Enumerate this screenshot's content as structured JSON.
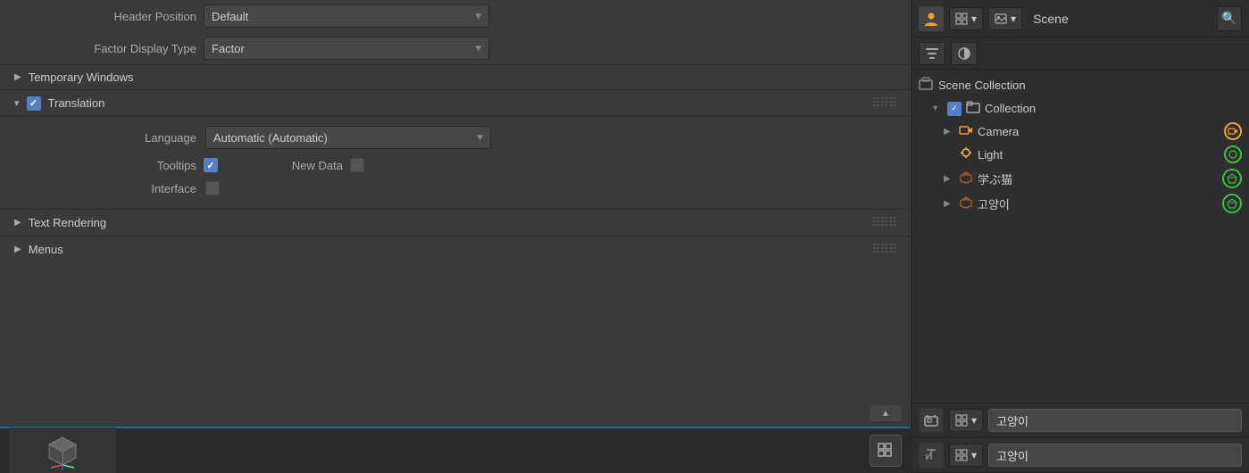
{
  "header_position": {
    "label": "Header Position",
    "dropdown_value": "Default",
    "dropdown_arrow": "▾"
  },
  "factor_display": {
    "label": "Factor Display Type",
    "dropdown_value": "Factor",
    "dropdown_arrow": "▾"
  },
  "temporary_windows": {
    "label": "Temporary Windows",
    "arrow": "▶"
  },
  "translation": {
    "header_arrow": "▾",
    "title": "Translation",
    "dots": "⠿⠿⠿",
    "language_label": "Language",
    "language_value": "Automatic (Automatic)",
    "language_arrow": "▾",
    "tooltips_label": "Tooltips",
    "new_data_label": "New Data",
    "interface_label": "Interface"
  },
  "text_rendering": {
    "label": "Text Rendering",
    "arrow": "▶",
    "dots": "⠿⠿⠿"
  },
  "menus": {
    "label": "Menus",
    "arrow": "▶",
    "dots": "⠿⠿⠿"
  },
  "right_panel": {
    "scene_label": "Scene",
    "user_icon": "👤",
    "search_icon": "🔍",
    "scene_collection_label": "Scene Collection",
    "collection_label": "Collection",
    "camera_label": "Camera",
    "light_label": "Light",
    "manekineko_label": "学ぶ猫",
    "cat_label": "고양이",
    "bottom_name_1": "고양이",
    "bottom_name_2": "고양이"
  }
}
